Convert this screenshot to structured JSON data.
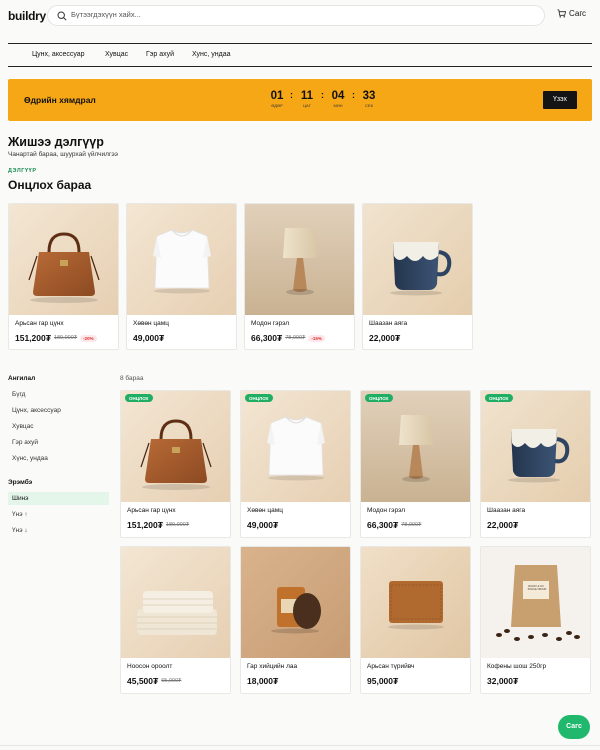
{
  "header": {
    "logo": "buildry",
    "search_placeholder": "Бүтээгдэхүүн хайх...",
    "cart_label": "Сагс"
  },
  "nav": [
    "Цунх, аксессуар",
    "Хувцас",
    "Гэр ахуй",
    "Хунс, ундаа"
  ],
  "deal": {
    "title": "Өдрийн хямдрал",
    "timer": [
      {
        "value": "01",
        "unit": "ӨДӨР"
      },
      {
        "value": "11",
        "unit": "ЦАГ"
      },
      {
        "value": "04",
        "unit": "МИН"
      },
      {
        "value": "33",
        "unit": "СЕК"
      }
    ],
    "button": "Үзэх"
  },
  "shop": {
    "name": "Жишээ дэлгүүр",
    "subtitle": "Чанартай бараа, шуурхай үйлчилгээ"
  },
  "featured": {
    "label": "ДЭЛГҮҮР",
    "title": "Онцлох бараа",
    "items": [
      {
        "name": "Арьсан гар цүнх",
        "price": "151,200₮",
        "old": "189,000₮",
        "discount": "-20%",
        "image": "handbag-icon"
      },
      {
        "name": "Хөвөн цамц",
        "price": "49,000₮",
        "old": "",
        "discount": "",
        "image": "tshirt-icon"
      },
      {
        "name": "Модон гэрэл",
        "price": "66,300₮",
        "old": "78,000₮",
        "discount": "-15%",
        "image": "lamp-icon"
      },
      {
        "name": "Шаазан аяга",
        "price": "22,000₮",
        "old": "",
        "discount": "",
        "image": "mug-icon"
      }
    ]
  },
  "sidebar": {
    "category_title": "Ангилал",
    "categories": [
      "Бүгд",
      "Цүнх, аксессуар",
      "Хувцас",
      "Гэр ахуй",
      "Хүнс, ундаа"
    ],
    "sort_title": "Эрэмбэ",
    "sorts": [
      "Шинэ",
      "Үнэ ↑",
      "Үнэ ↓"
    ],
    "selected_sort": "Шинэ"
  },
  "grid": {
    "count_label": "8 бараа",
    "badge": "ОНЦЛОХ",
    "items": [
      {
        "name": "Арьсан гар цүнх",
        "price": "151,200₮",
        "old": "189,000₮",
        "image": "handbag-icon",
        "featured": true
      },
      {
        "name": "Хөвөн цамц",
        "price": "49,000₮",
        "old": "",
        "image": "tshirt-icon",
        "featured": true
      },
      {
        "name": "Модон гэрэл",
        "price": "66,300₮",
        "old": "78,000₮",
        "image": "lamp-icon",
        "featured": true
      },
      {
        "name": "Шаазан аяга",
        "price": "22,000₮",
        "old": "",
        "image": "mug-icon",
        "featured": true
      },
      {
        "name": "Ноосон ороолт",
        "price": "45,500₮",
        "old": "65,000₮",
        "image": "blanket-icon",
        "featured": false
      },
      {
        "name": "Гар хийцийн лаа",
        "price": "18,000₮",
        "old": "",
        "image": "candle-icon",
        "featured": false
      },
      {
        "name": "Арьсан түрийвч",
        "price": "95,000₮",
        "old": "",
        "image": "wallet-icon",
        "featured": false
      },
      {
        "name": "Кофены шош 250гр",
        "price": "32,000₮",
        "old": "",
        "image": "coffee-bag-icon",
        "featured": false
      }
    ],
    "coffee_label": "ROAST & CO. · SINGLE ORIGIN"
  },
  "chat_button": "Сагс",
  "colors": {
    "accent_orange": "#f6a716",
    "green": "#1fae63",
    "discount_red": "#d33333"
  }
}
